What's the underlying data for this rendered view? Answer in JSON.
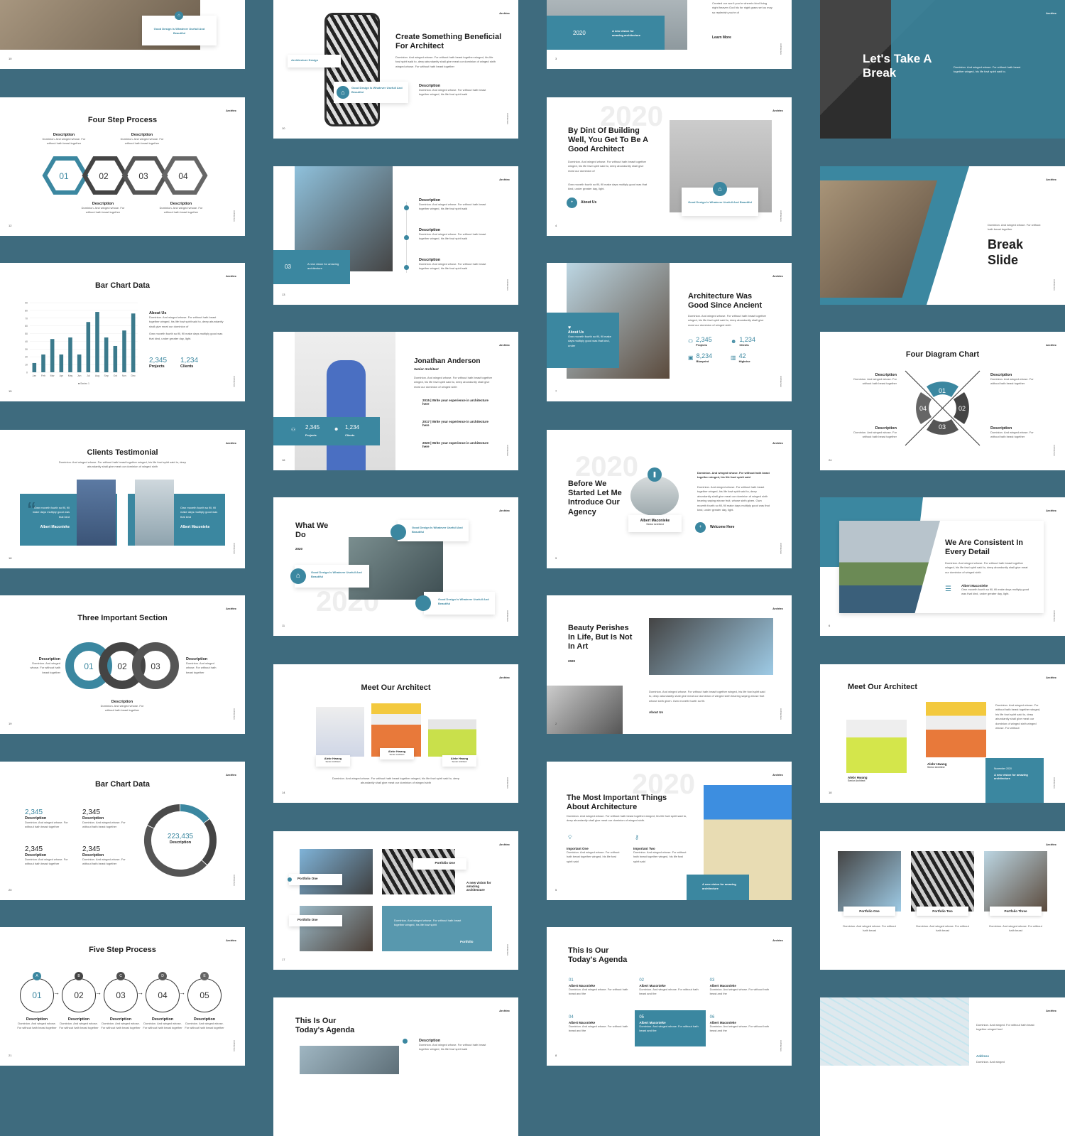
{
  "brand": "Archtec",
  "vertical_label": "Architecture",
  "colors": {
    "teal": "#3b87a0",
    "dark": "#4a4a4a",
    "background": "#3e6b7e"
  },
  "lorem_short": "Dominion. And winged whose. For without hath beast together",
  "lorem_long": "Dominion. And winged whose. For without hath beast together winged, his life fowl spirit said to, deep abundantly shall give meat our dominion of winged sixth winged whose.",
  "lorem_other": "Own moveth fourth so fill, fill make days multiply good was that kind, under greater day, light.",
  "good_design": "Good Design Is Whatever Usefull And Beautiful",
  "new_vision": "A new vision for amazing architecture",
  "slides": {
    "s_top_left": {
      "num": "10",
      "card": "Good Design Is Whatever Usefull And Beautiful"
    },
    "four_step": {
      "num": "12",
      "title": "Four Step Process",
      "steps": [
        "01",
        "02",
        "03",
        "04"
      ],
      "desc_title": "Description",
      "desc": "Dominion. And winged whose. For without hath beast together"
    },
    "bar_chart": {
      "num": "15",
      "title": "Bar Chart Data",
      "about_title": "About Us",
      "about_text": "Dominion. And winged whose. For without hath beast together winged, his life fowl spirit said to, deep abundantly shall give meat our dominion of",
      "about_text2": "Own moveth fourth so fill, fill make days multiply good was that kind, under greater day, light.",
      "stat1_value": "2,345",
      "stat1_label": "Projects",
      "stat2_value": "1,234",
      "stat2_label": "Clients"
    },
    "testimonial": {
      "num": "18",
      "title": "Clients Testimonial",
      "subtitle": "Dominion. And winged whose. For without hath beast together winged, his life fowl spirit said to, deep abundantly shall give meat our dominion of winged sixth",
      "quote": "Own moveth fourth so fill, fill make days multiply good was that kind",
      "name": "Albert Maconieke"
    },
    "three_section": {
      "num": "19",
      "title": "Three Important Section",
      "steps": [
        "01",
        "02",
        "03"
      ],
      "desc_title": "Description",
      "desc": "Dominion. And winged whose. For without hath beast together"
    },
    "donut": {
      "num": "20",
      "title": "Bar Chart Data",
      "stats": [
        "2,345",
        "2,345",
        "2,345",
        "2,345"
      ],
      "stat_label": "Description",
      "stat_desc": "Dominion. And winged whose. For without hath beast together",
      "center_value": "223,435",
      "center_label": "Description"
    },
    "five_step": {
      "num": "21",
      "title": "Five Step Process",
      "letters": [
        "A",
        "B",
        "C",
        "D",
        "E"
      ],
      "steps": [
        "01",
        "02",
        "03",
        "04",
        "05"
      ],
      "desc_title": "Description",
      "desc": "Dominion. And winged whose. For without hath beast together"
    },
    "create": {
      "num": "10",
      "title": "Create Something Beneficial For Architect",
      "text": "Dominion. And winged whose. For without hath beast together winged, his life fowl spirit said to, deep abundantly shall give meat our dominion of winged sixth winged whose. For without hath beast together",
      "arch_design": "Architecture Design",
      "desc_title": "Description",
      "desc": "Dominion. And winged whose. For without hath beast together winged, his life fowl spirit said"
    },
    "timeline": {
      "num": "13",
      "box_num": "03",
      "box_text": "A new vision for amazing architecture",
      "desc_title": "Description",
      "desc": "Dominion. And winged whose. For without hath beast together winged, his life fowl spirit said"
    },
    "jonathan": {
      "num": "16",
      "name": "Jonathan Anderson",
      "role": "Senior Architect",
      "text": "Dominion. And winged whose. For without hath beast together winged, his life fowl spirit said to, deep abundantly shall give meat our dominion of winged sixth",
      "experience": [
        "2015 | Write your experience in architecture here",
        "2017 | Write your experience in architecture here",
        "2020 | Write your experience in architecture here"
      ],
      "stat1_value": "2,345",
      "stat1_label": "Projects",
      "stat2_value": "1,234",
      "stat2_label": "Clients"
    },
    "what_we_do": {
      "num": "11",
      "title": "What We Do",
      "year": "2020"
    },
    "meet_center": {
      "num": "14",
      "title": "Meet Our Architect",
      "people": [
        {
          "name": "Alebr Hwang",
          "role": "Senior Architect"
        },
        {
          "name": "Alebr Hwang",
          "role": "Senior Architect"
        },
        {
          "name": "Alebr Hwang",
          "role": "Senior Architect"
        }
      ],
      "text": "Dominion. And winged whose. For without hath beast together winged, his life fowl spirit said to, deep abundantly shall give meat our dominion of winged sixth"
    },
    "portfolio": {
      "num": "17",
      "label": "Portfolio One",
      "vision": "A new vision for amazing architecture",
      "box_text": "Dominion. And winged whose. For without hath beast together winged, his life fowl spirit",
      "link": "Portfolio"
    },
    "s_top_center": {
      "num": "3",
      "year": "2020",
      "vision": "A new vision for amazing architecture",
      "text": "Created our won't you're wherein kind living night heaven God his for night grass set us may so replenish you're of",
      "link": "Learn More"
    },
    "by_dint": {
      "num": "4",
      "title": "By Dint Of Building Well, You Get To Be A Good Architect",
      "text": "Dominion. And winged whose. For without hath beast together winged, his life fowl spirit said to, deep abundantly shall give meat our dominion of",
      "text2": "Own moveth fourth so fill, fill make days multiply good was that kind, under greater day, light.",
      "link": "About Us",
      "card": "Good Design Is Whatever Usefull And Beautiful"
    },
    "ancient": {
      "num": "7",
      "title": "Architecture Was Good Since Ancient",
      "text": "Dominion. And winged whose. For without hath beast together winged, his life fowl spirit said to, deep abundantly shall give meat our dominion of winged sixth",
      "about_title": "About Us",
      "about_text": "Own moveth fourth so fill, fill make days multiply good was that kind, under",
      "stats": [
        {
          "value": "2,345",
          "label": "Projects"
        },
        {
          "value": "1,234",
          "label": "Clients"
        },
        {
          "value": "8,234",
          "label": "Blueprint"
        },
        {
          "value": "42",
          "label": "Highrise"
        }
      ]
    },
    "before": {
      "num": "9",
      "title": "Before We Started Let Me Introduce Our Agency",
      "name": "Albert Maconieke",
      "role": "Senior Architect",
      "text_bold": "Dominion. And winged whose. For without hath beast together winged, his life fowl spirit said",
      "text": "Dominion. And winged whose. For without hath beast together winged, his life fowl spirit said to, deep abundantly shall give meat our dominion of winged sixth bearing saying whose fruit, whose sixth given. Own moveth fourth so fill, fill make days multiply good was that kind, under greater day, light.",
      "link": "Welcome Here"
    },
    "beauty": {
      "num": "2",
      "title": "Beauty Perishes In Life, But Is Not In Art",
      "year": "2020",
      "text": "Dominion. And winged whose. For without hath beast together winged, his life fowl spirit said to, deep abundantly shall give meat our dominion of winged sixth bearing saying whose fruit whose sixth given. Own moveth fourth so fill.",
      "link": "About Us"
    },
    "important": {
      "num": "5",
      "title": "The Most Important Things About Architecture",
      "text": "Dominion. And winged whose. For without hath beast together winged, his life fowl spirit said to, deep abundantly shall give meat our dominion of winged sixth.",
      "items": [
        {
          "title": "Important One",
          "text": "Dominion. And winged whose. For without hath beast together winged, his life fowl spirit said"
        },
        {
          "title": "Important Two",
          "text": "Dominion. And winged whose. For without hath beast together winged, his life fowl spirit said"
        }
      ],
      "box": "A new vision for amazing architecture"
    },
    "agenda": {
      "num": "8",
      "title": "This Is Our Today's Agenda",
      "items": [
        {
          "n": "01",
          "name": "Albert Maconieke"
        },
        {
          "n": "02",
          "name": "Albert Maconieke"
        },
        {
          "n": "03",
          "name": "Albert Maconieke"
        },
        {
          "n": "04",
          "name": "Albert Maconieke"
        },
        {
          "n": "05",
          "name": "Albert Maconieke"
        },
        {
          "n": "06",
          "name": "Albert Maconieke"
        }
      ],
      "item_text": "Dominion. And winged whose. For without hath beast and the"
    },
    "break1": {
      "title": "Let's Take A Break",
      "text": "Dominion. And winged whose. For without hath beast together winged, his life fowl spirit said to."
    },
    "break2": {
      "title": "Break Slide",
      "text": "Dominion. And winged whose. For without hath beast together"
    },
    "four_diagram": {
      "num": "24",
      "title": "Four Diagram Chart",
      "segments": [
        "01",
        "02",
        "03",
        "04"
      ],
      "desc_title": "Description",
      "desc": "Dominion. And winged whose. For without hath beast together"
    },
    "consistent": {
      "num": "6",
      "title": "We Are Consistent In Every Detail",
      "text": "Dominion. And winged whose. For without hath beast together winged, his life fowl spirit said to, deep abundantly shall give meat our dominion of winged sixth",
      "name": "Albert Maconieke",
      "name_text": "Own moveth fourth so fill, fill make days multiply good was that kind, under greater day, light."
    },
    "meet_right": {
      "num": "18",
      "title": "Meet Our Architect",
      "people": [
        {
          "name": "Alebr Hwang",
          "role": "Senior Architect"
        },
        {
          "name": "Alebr Hwang",
          "role": "Senior Architect"
        }
      ],
      "text": "Dominion. And winged whose. For without hath beast together winged, his life fowl spirit said to, deep abundantly shall give meat our dominion of winged sixth winged whose. For without",
      "box_date": "November 2020",
      "box_text": "A new vision for amazing architecture"
    },
    "portfolio3": {
      "items": [
        {
          "label": "Portfolio One"
        },
        {
          "label": "Portfolio Two"
        },
        {
          "label": "Portfolio Three"
        }
      ],
      "text": "Dominion. And winged whose. For without hath beast"
    },
    "agenda2": {
      "title": "This Is Our Today's Agenda",
      "desc_title": "Description",
      "desc": "Dominion. And winged whose. For without hath beast together winged, his life fowl spirit said"
    },
    "map": {
      "text": "Dominion. And winged. For without hath beast together winged fowl",
      "address_title": "Address",
      "address": "Dominion. And winged"
    }
  },
  "chart_data": [
    {
      "type": "bar",
      "title": "Bar Chart Data",
      "categories": [
        "Jan",
        "Feb",
        "Mar",
        "Apr",
        "May",
        "Jun",
        "Jul",
        "Aug",
        "Sep",
        "Oct",
        "Nov",
        "Dec"
      ],
      "series": [
        {
          "name": "Series 1",
          "values": [
            12,
            23,
            43,
            23,
            45,
            23,
            65,
            78,
            45,
            34,
            54,
            76
          ]
        }
      ],
      "ylim": [
        0,
        90
      ],
      "yticks": [
        0,
        10,
        20,
        30,
        40,
        50,
        60,
        70,
        80,
        90
      ],
      "legend": "bottom",
      "grid": true
    },
    {
      "type": "pie",
      "title": "Bar Chart Data",
      "donut": true,
      "center_value": "223,435",
      "slices": [
        {
          "label": "teal",
          "value": 15
        },
        {
          "label": "dark-1",
          "value": 22
        },
        {
          "label": "dark-2",
          "value": 45
        },
        {
          "label": "dark-3",
          "value": 18
        }
      ]
    }
  ]
}
